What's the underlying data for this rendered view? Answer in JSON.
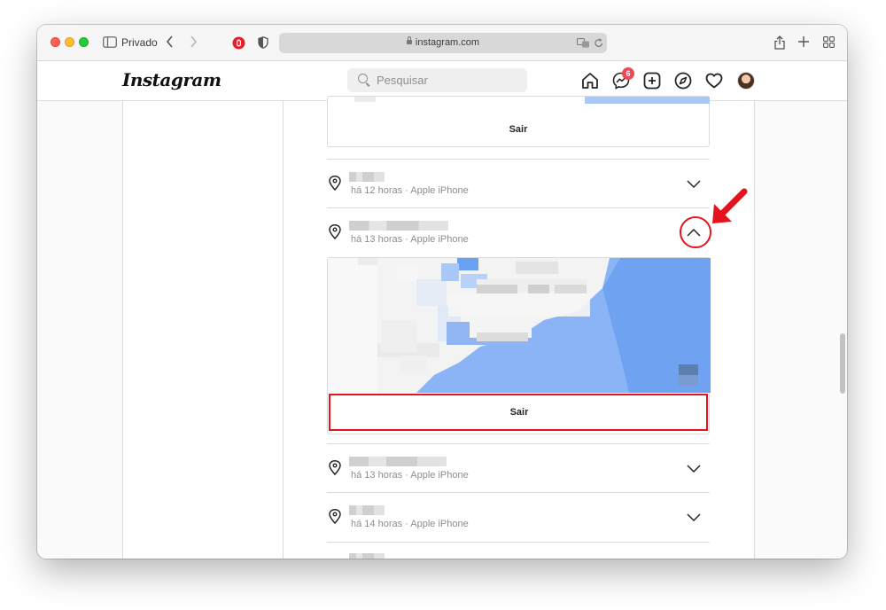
{
  "browser": {
    "private_label": "Privado",
    "url": "instagram.com"
  },
  "header": {
    "logo": "Instagram",
    "search_placeholder": "Pesquisar",
    "messages_badge": "6"
  },
  "sessions": {
    "top_card": {
      "button_label": "Sair"
    },
    "items": [
      {
        "meta": "há 12 horas · Apple iPhone",
        "expanded": false
      },
      {
        "meta": "há 13 horas · Apple iPhone",
        "expanded": true,
        "button_label": "Sair"
      },
      {
        "meta": "há 13 horas · Apple iPhone",
        "expanded": false
      },
      {
        "meta": "há 14 horas · Apple iPhone",
        "expanded": false
      }
    ]
  },
  "colors": {
    "annotation_red": "#e5131d",
    "map_water": "#6aa2f3",
    "badge": "#ed4956"
  }
}
